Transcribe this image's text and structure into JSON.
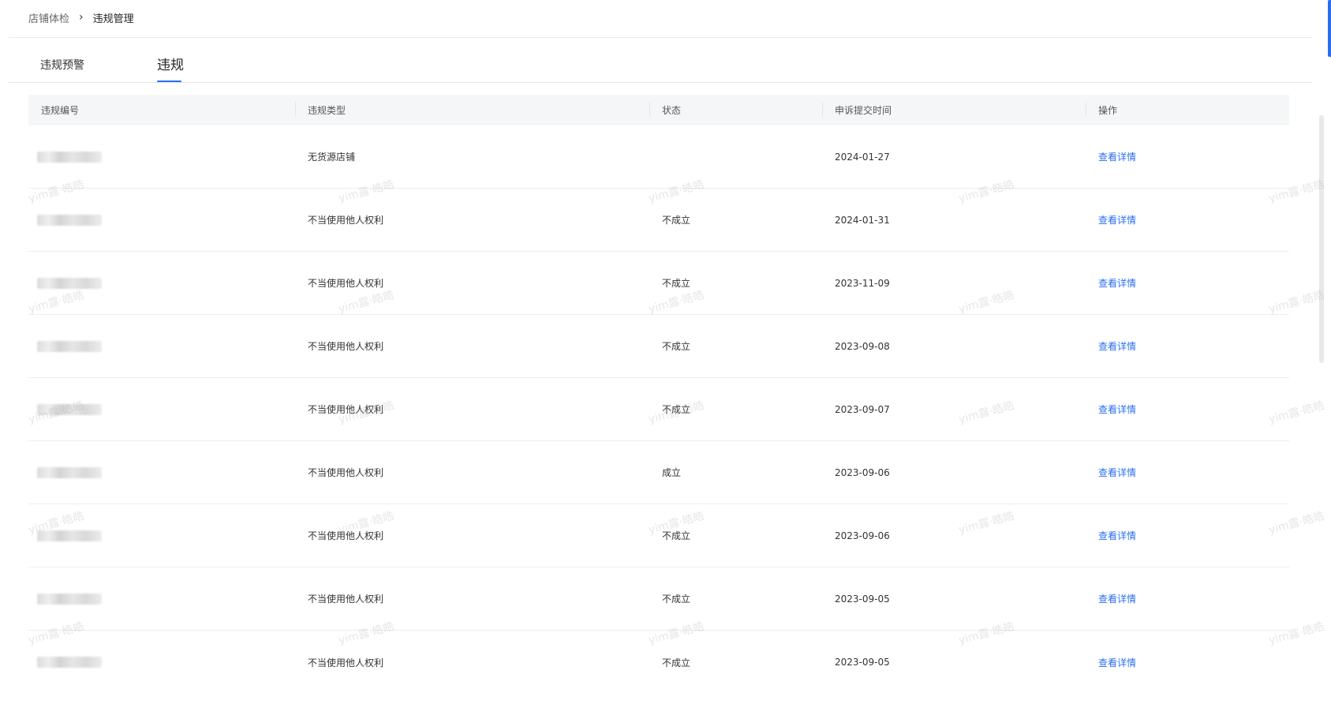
{
  "breadcrumb": {
    "parent": "店铺体检",
    "separator": "›",
    "current": "违规管理"
  },
  "tabs": [
    {
      "label": "违规预警",
      "active": false
    },
    {
      "label": "违规",
      "active": true
    }
  ],
  "accent_color": "#2a6ef0",
  "table": {
    "columns": [
      "违规编号",
      "违规类型",
      "状态",
      "申诉提交时间",
      "操作"
    ],
    "rows": [
      {
        "id": "",
        "type": "无货源店铺",
        "status": "",
        "time": "2024-01-27",
        "action": "查看详情"
      },
      {
        "id": "",
        "type": "不当使用他人权利",
        "status": "不成立",
        "time": "2024-01-31",
        "action": "查看详情"
      },
      {
        "id": "",
        "type": "不当使用他人权利",
        "status": "不成立",
        "time": "2023-11-09",
        "action": "查看详情"
      },
      {
        "id": "",
        "type": "不当使用他人权利",
        "status": "不成立",
        "time": "2023-09-08",
        "action": "查看详情"
      },
      {
        "id": "",
        "type": "不当使用他人权利",
        "status": "不成立",
        "time": "2023-09-07",
        "action": "查看详情"
      },
      {
        "id": "",
        "type": "不当使用他人权利",
        "status": "成立",
        "time": "2023-09-06",
        "action": "查看详情"
      },
      {
        "id": "",
        "type": "不当使用他人权利",
        "status": "不成立",
        "time": "2023-09-06",
        "action": "查看详情"
      },
      {
        "id": "",
        "type": "不当使用他人权利",
        "status": "不成立",
        "time": "2023-09-05",
        "action": "查看详情"
      },
      {
        "id": "",
        "type": "不当使用他人权利",
        "status": "不成立",
        "time": "2023-09-05",
        "action": "查看详情"
      }
    ]
  },
  "watermark": "yim露·皓皓"
}
